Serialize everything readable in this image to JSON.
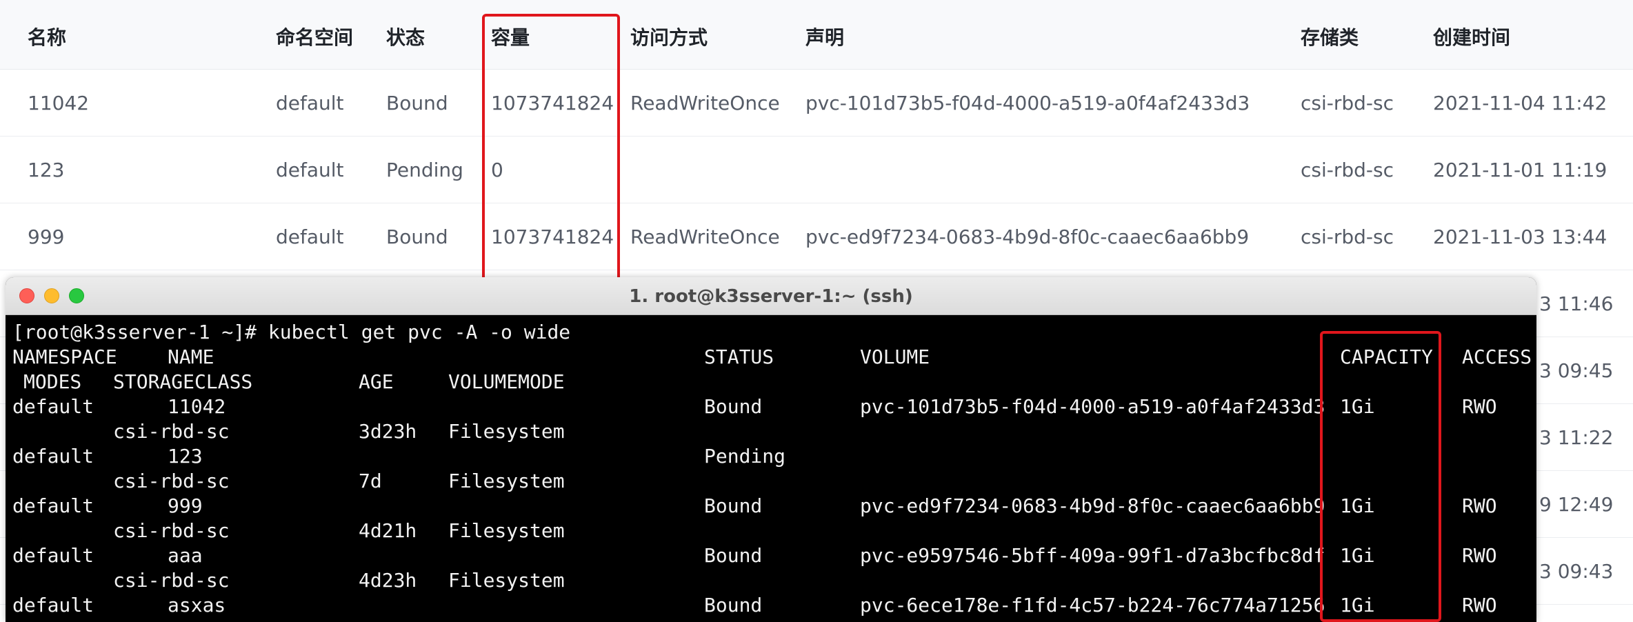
{
  "table": {
    "headers": {
      "name": "名称",
      "namespace": "命名空间",
      "status": "状态",
      "capacity": "容量",
      "access_mode": "访问方式",
      "claim": "声明",
      "storage_class": "存储类",
      "created": "创建时间"
    },
    "rows": [
      {
        "name": "11042",
        "namespace": "default",
        "status": "Bound",
        "capacity": "1073741824",
        "access_mode": "ReadWriteOnce",
        "claim": "pvc-101d73b5-f04d-4000-a519-a0f4af2433d3",
        "storage_class": "csi-rbd-sc",
        "created": "2021-11-04 11:42"
      },
      {
        "name": "123",
        "namespace": "default",
        "status": "Pending",
        "capacity": "0",
        "access_mode": "",
        "claim": "",
        "storage_class": "csi-rbd-sc",
        "created": "2021-11-01 11:19"
      },
      {
        "name": "999",
        "namespace": "default",
        "status": "Bound",
        "capacity": "1073741824",
        "access_mode": "ReadWriteOnce",
        "claim": "pvc-ed9f7234-0683-4b9d-8f0c-caaec6aa6bb9",
        "storage_class": "csi-rbd-sc",
        "created": "2021-11-03 13:44"
      }
    ],
    "partial_times": [
      "3 11:46",
      "3 09:45",
      "3 11:22",
      "9 12:49",
      "3 09:43"
    ]
  },
  "terminal": {
    "title": "1. root@k3sserver-1:~ (ssh)",
    "prompt_line": "[root@k3sserver-1 ~]# kubectl get pvc -A -o wide",
    "header": {
      "namespace": "NAMESPACE",
      "name": "NAME",
      "status": "STATUS",
      "volume": "VOLUME",
      "capacity": "CAPACITY",
      "access": "ACCESS",
      "modes": "MODES",
      "storageclass": "STORAGECLASS",
      "age": "AGE",
      "volumemode": "VOLUMEMODE"
    },
    "rows": [
      {
        "namespace": "default",
        "name": "11042",
        "status": "Bound",
        "volume": "pvc-101d73b5-f04d-4000-a519-a0f4af2433d3",
        "capacity": "1Gi",
        "access": "RWO",
        "storageclass": "csi-rbd-sc",
        "age": "3d23h",
        "volumemode": "Filesystem"
      },
      {
        "namespace": "default",
        "name": "123",
        "status": "Pending",
        "volume": "",
        "capacity": "",
        "access": "",
        "storageclass": "csi-rbd-sc",
        "age": "7d",
        "volumemode": "Filesystem"
      },
      {
        "namespace": "default",
        "name": "999",
        "status": "Bound",
        "volume": "pvc-ed9f7234-0683-4b9d-8f0c-caaec6aa6bb9",
        "capacity": "1Gi",
        "access": "RWO",
        "storageclass": "csi-rbd-sc",
        "age": "4d21h",
        "volumemode": "Filesystem"
      },
      {
        "namespace": "default",
        "name": "aaa",
        "status": "Bound",
        "volume": "pvc-e9597546-5bff-409a-99f1-d7a3bcfbc8df",
        "capacity": "1Gi",
        "access": "RWO",
        "storageclass": "csi-rbd-sc",
        "age": "4d23h",
        "volumemode": "Filesystem"
      },
      {
        "namespace": "default",
        "name": "asxas",
        "status": "Bound",
        "volume": "pvc-6ece178e-f1fd-4c57-b224-76c774a71256",
        "capacity": "1Gi",
        "access": "RWO",
        "storageclass": "",
        "age": "",
        "volumemode": ""
      }
    ]
  },
  "colors": {
    "highlight": "#e0161c",
    "terminal_bg": "#000000",
    "terminal_fg": "#f2f2f2",
    "traffic_red": "#fe5f57",
    "traffic_yellow": "#febc2e",
    "traffic_green": "#28c840"
  }
}
